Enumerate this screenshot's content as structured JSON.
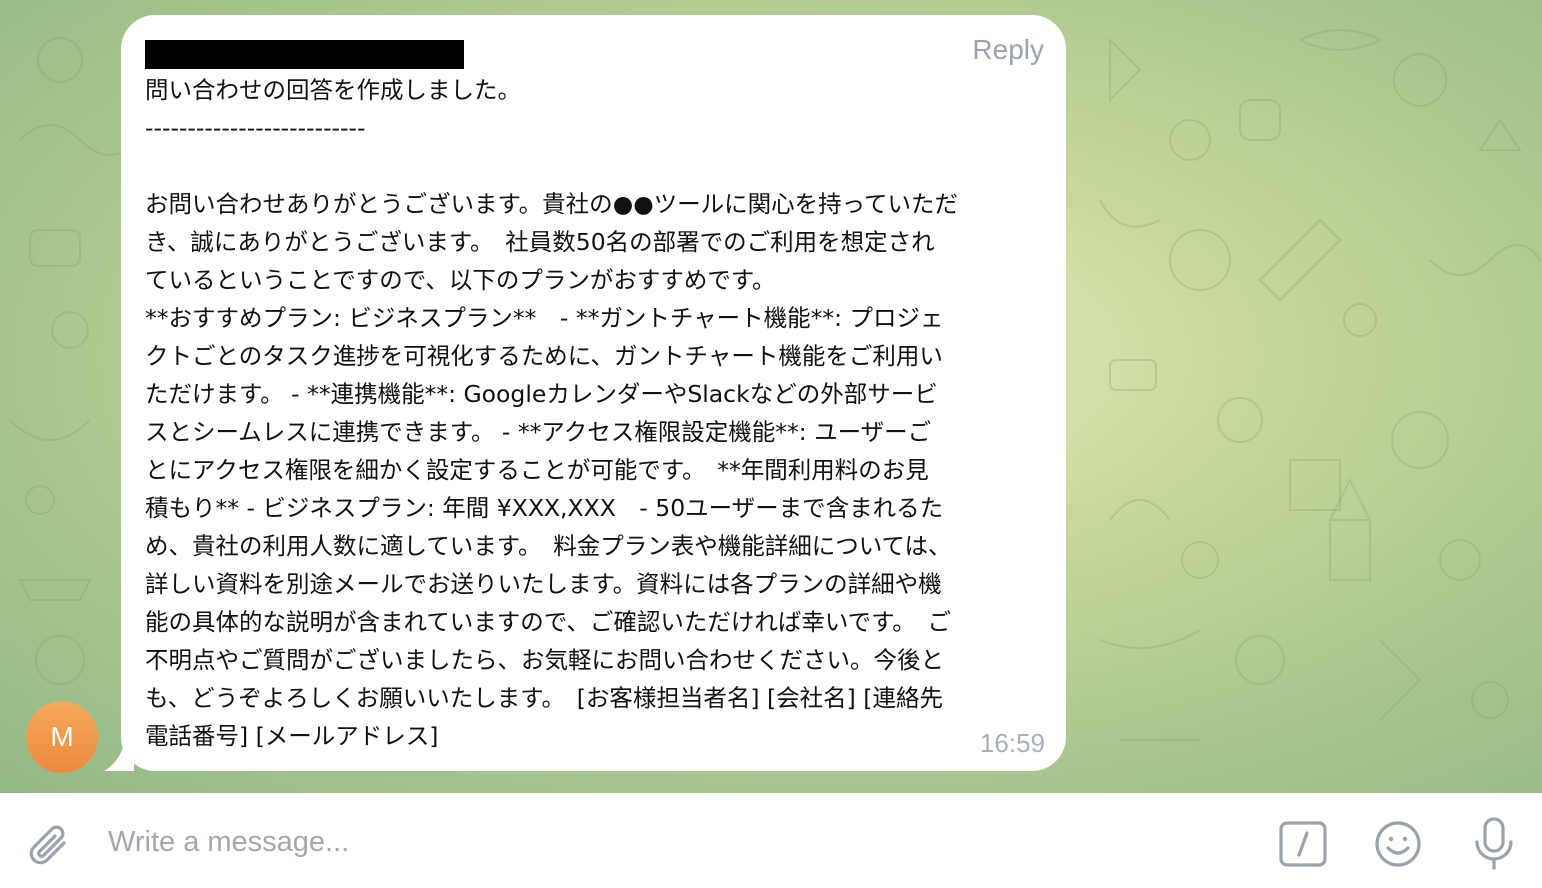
{
  "message": {
    "reply_label": "Reply",
    "time": "16:59",
    "lines": [
      "問い合わせの回答を作成しました。",
      "--------------------------",
      "",
      "お問い合わせありがとうございます。貴社の●●ツールに関心を持っていただ",
      "き、誠にありがとうございます。　社員数50名の部署でのご利用を想定され",
      "ているということですので、以下のプランがおすすめです。",
      "**おすすめプラン: ビジネスプラン**　- **ガントチャート機能**: プロジェ",
      "クトごとのタスク進捗を可視化するために、ガントチャート機能をご利用い",
      "ただけます。 - **連携機能**: GoogleカレンダーやSlackなどの外部サービ",
      "スとシームレスに連携できます。 - **アクセス権限設定機能**: ユーザーご",
      "とにアクセス権限を細かく設定することが可能です。　**年間利用料のお見",
      "積もり** - ビジネスプラン: 年間 ¥XXX,XXX　- 50ユーザーまで含まれるた",
      "め、貴社の利用人数に適しています。　料金プラン表や機能詳細については、",
      "詳しい資料を別途メールでお送りいたします。資料には各プランの詳細や機",
      "能の具体的な説明が含まれていますので、ご確認いただければ幸いです。　ご",
      "不明点やご質問がございましたら、お気軽にお問い合わせください。今後と",
      "も、どうぞよろしくお願いいたします。　[お客様担当者名] [会社名] [連絡先",
      "電話番号] [メールアドレス]"
    ]
  },
  "sender": {
    "avatar_initial": "M",
    "avatar_color": "#ef9246"
  },
  "composer": {
    "placeholder": "Write a message...",
    "icons": [
      "paperclip-icon",
      "bot-commands-icon",
      "emoji-icon",
      "microphone-icon"
    ]
  },
  "colors": {
    "bubble": "#ffffff",
    "meta_text": "#a9b0b8",
    "icon": "#9aa3ad"
  }
}
